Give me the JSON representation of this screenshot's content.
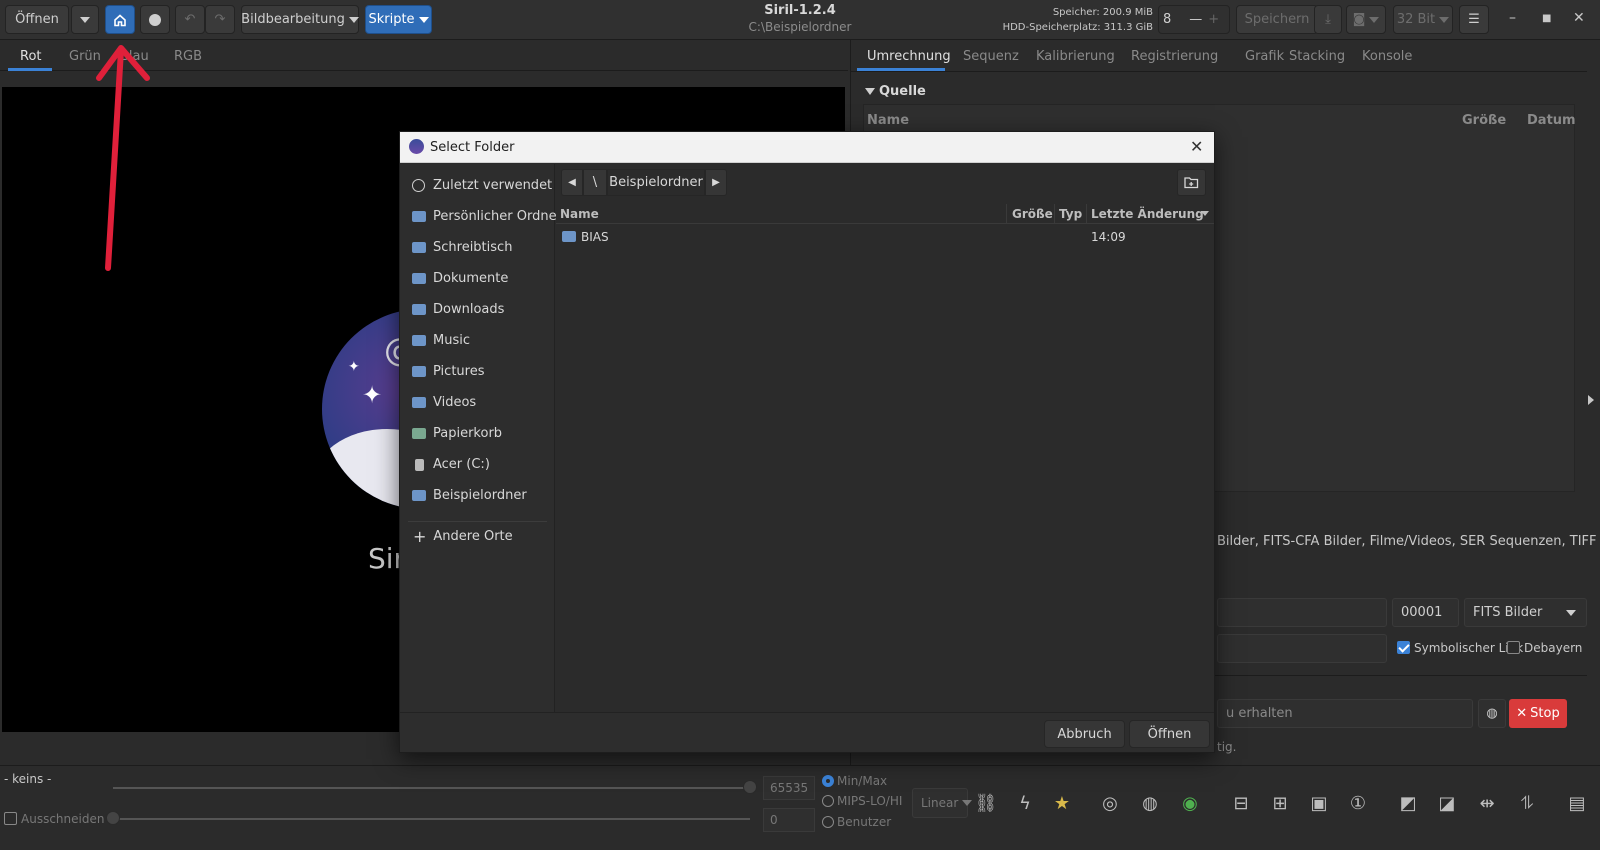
{
  "header": {
    "open_label": "Öffnen",
    "image_processing_label": "Bildbearbeitung",
    "scripts_label": "Skripte",
    "app_title": "Siril-1.2.4",
    "working_dir": "C:\\Beispielordner",
    "memory": "Speicher: 200.9 MiB",
    "disk": "HDD-Speicherplatz: 311.3 GiB",
    "threads": "8",
    "save_label": "Speichern",
    "bit_depth": "32 Bit",
    "accent_color": "#2f6db8"
  },
  "channel_tabs": [
    "Rot",
    "Grün",
    "Blau",
    "RGB"
  ],
  "canvas": {
    "logo_text": "Siril"
  },
  "right_panel": {
    "tabs": [
      "Umrechnung",
      "Sequenz",
      "Kalibrierung",
      "Registrierung",
      "Grafik",
      "Stacking",
      "Konsole"
    ],
    "source_label": "Quelle",
    "columns": {
      "name": "Name",
      "size": "Größe",
      "date": "Datum"
    },
    "partial_text": "Bilder, FITS-CFA Bilder, Filme/Videos, SER Sequenzen, TIFF Bilder,",
    "index_value": "00001",
    "output_format": "FITS Bilder",
    "symlink_label": "Symbolischer Link",
    "debayer_label": "Debayern",
    "partial_status": "u erhalten",
    "partial_status2": "tig.",
    "stop_label": "Stop"
  },
  "bottom": {
    "image_name": "- keins -",
    "crop_label": "Ausschneiden",
    "high_value": "65535",
    "low_value": "0",
    "radio_minmax": "Min/Max",
    "radio_mips": "MIPS-LO/HI",
    "radio_user": "Benutzer",
    "stretch_mode": "Linear"
  },
  "dialog": {
    "title": "Select Folder",
    "places": [
      "Zuletzt verwendet",
      "Persönlicher Ordner",
      "Schreibtisch",
      "Dokumente",
      "Downloads",
      "Music",
      "Pictures",
      "Videos",
      "Papierkorb",
      "Acer (C:)",
      "Beispielordner"
    ],
    "other_places": "Andere Orte",
    "path_root": "\\",
    "path_current": "Beispielordner",
    "columns": {
      "name": "Name",
      "size": "Größe",
      "type": "Typ",
      "modified": "Letzte Änderung"
    },
    "files": [
      {
        "name": "BIAS",
        "size": "",
        "type": "",
        "modified": "14:09"
      }
    ],
    "cancel_label": "Abbruch",
    "open_label": "Öffnen"
  },
  "annotation": {
    "arrow_color": "#e0203a"
  }
}
